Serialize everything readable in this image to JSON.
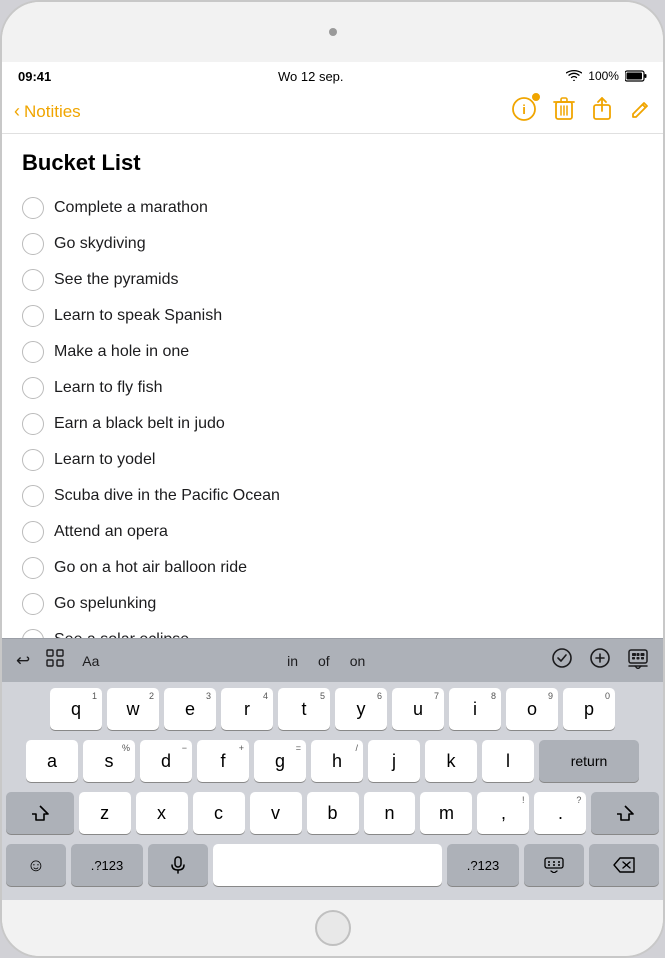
{
  "device": {
    "camera": "camera-dot"
  },
  "statusBar": {
    "time": "09:41",
    "date": "Wo 12 sep.",
    "wifi": "📶",
    "battery": "100%"
  },
  "navBar": {
    "backLabel": "Notities",
    "icons": {
      "alert": "alert-circle",
      "delete": "trash",
      "share": "share",
      "edit": "edit"
    }
  },
  "note": {
    "title": "Bucket List",
    "items": [
      "Complete a marathon",
      "Go skydiving",
      "See the pyramids",
      "Learn to speak Spanish",
      "Make a hole in one",
      "Learn to fly fish",
      "Earn a black belt in judo",
      "Learn to yodel",
      "Scuba dive in the Pacific Ocean",
      "Attend an opera",
      "Go on a hot air balloon ride",
      "Go spelunking",
      "See a solar eclipse"
    ]
  },
  "keyboard": {
    "toolbar": {
      "undo": "↩",
      "grid": "⊞",
      "format": "Aa",
      "word1": "in",
      "word2": "of",
      "word3": "on",
      "check": "✓",
      "add": "+",
      "keyboard": "⌨"
    },
    "rows": {
      "row1": [
        "q",
        "w",
        "e",
        "r",
        "t",
        "y",
        "u",
        "i",
        "o",
        "p"
      ],
      "row2": [
        "a",
        "s",
        "d",
        "f",
        "g",
        "h",
        "j",
        "k",
        "l"
      ],
      "row3": [
        "z",
        "x",
        "c",
        "v",
        "b",
        "n",
        "m"
      ],
      "alts": {
        "w": "2",
        "e": "3",
        "r": "4",
        "t": "5",
        "y": "6",
        "u": "7",
        "i": "8",
        "o": "9",
        "p": "0",
        "s": "%",
        "d": "−",
        "f": "+",
        "g": "=",
        "h": "/",
        "j": "−",
        "k": "−",
        "l": "−",
        "z": "−",
        "x": "−",
        "c": "−",
        "v": "−",
        "b": "−",
        "n": "−",
        "m": "−"
      }
    },
    "bottomRow": {
      "emoji": "☺",
      "symbol1": ".?123",
      "mic": "🎤",
      "space": "",
      "symbol2": ".?123",
      "keyboard": "⌨"
    },
    "returnLabel": "return",
    "deleteLabel": "⌫"
  }
}
